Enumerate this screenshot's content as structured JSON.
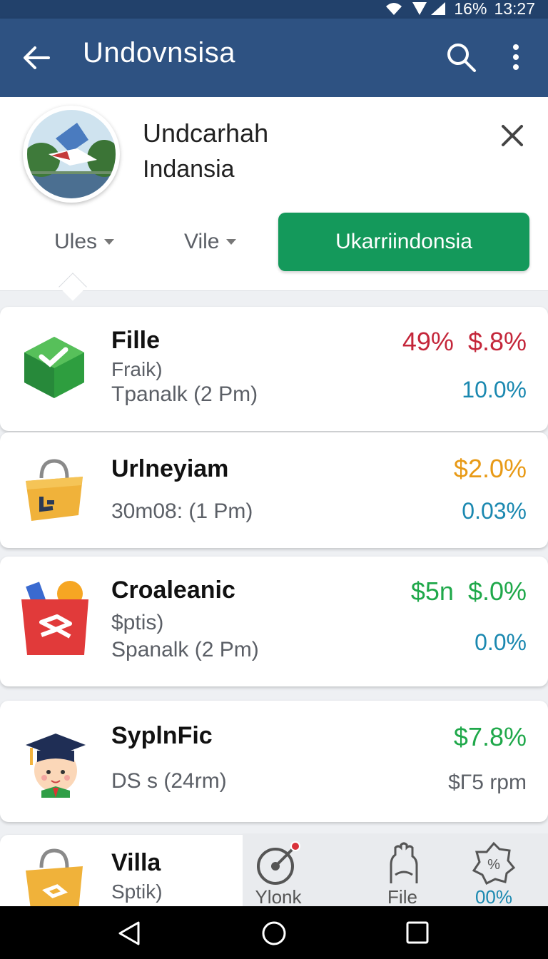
{
  "status": {
    "battery": "16%",
    "time": "13:27"
  },
  "appbar": {
    "title": "Undovnsisa"
  },
  "profile": {
    "name_line1": "Undcarhah",
    "name_line2": "Indansia"
  },
  "filters": [
    {
      "label": "Ules"
    },
    {
      "label": "Vile"
    }
  ],
  "primary_button": "Ukarriindonsia",
  "items": [
    {
      "title": "Fille",
      "line1": "Fraik)",
      "line2": "Tpanalk (2 Pm)",
      "value_a": "49%",
      "value_b": "$.8%",
      "value_c": "10.0%"
    },
    {
      "title": "Urlneyiam",
      "line1": "30m08: (1 Pm)",
      "value_a": "$2.0%",
      "value_c": "0.03%"
    },
    {
      "title": "Croaleanic",
      "line1": "$ptis)",
      "line2": "Spanalk (2 Pm)",
      "value_a": "$5n",
      "value_b": "$.0%",
      "value_c": "0.0%"
    },
    {
      "title": "SyplnFic",
      "line1": "DS s (24rm)",
      "value_a": "$7.8%",
      "value_c": "$Γ5 rpm"
    },
    {
      "title": "Villa",
      "line1": "Sptik)"
    }
  ],
  "bottom_nav": [
    {
      "label": "Ylonk"
    },
    {
      "label": "File"
    },
    {
      "label": "00%"
    }
  ],
  "colors": {
    "appbar": "#2e5282",
    "primary": "#14995b",
    "red": "#c4263a",
    "orange": "#e89a16",
    "green": "#1fa84a",
    "teal": "#1a88b0"
  }
}
